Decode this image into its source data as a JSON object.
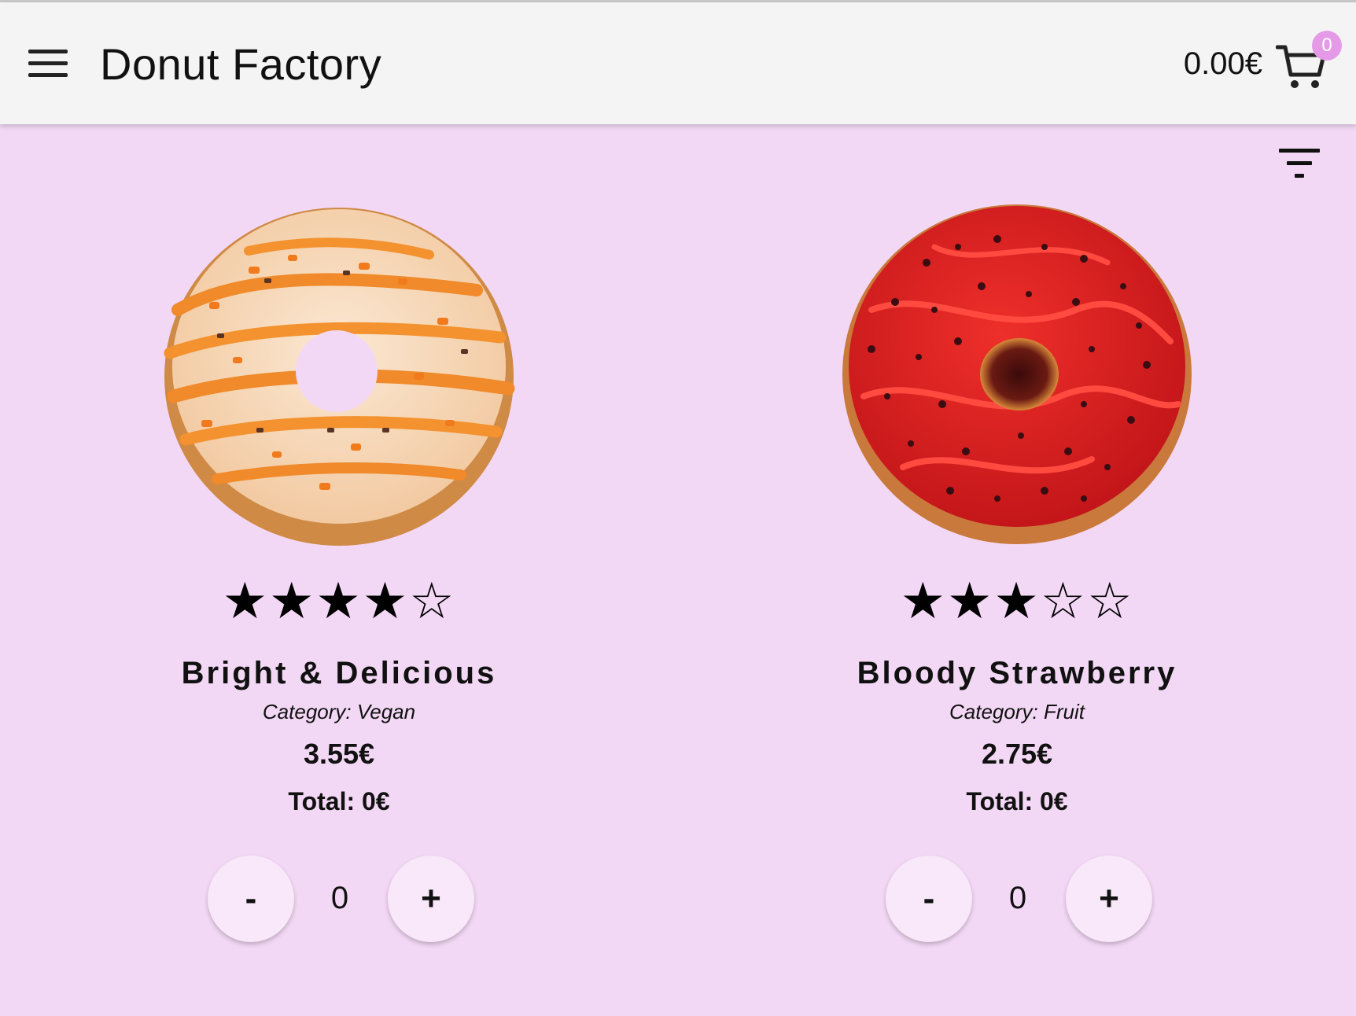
{
  "header": {
    "title": "Donut Factory",
    "cart_total": "0.00€",
    "cart_count": "0"
  },
  "icons": {
    "menu": "menu-icon",
    "cart": "cart-icon",
    "filter": "filter-icon"
  },
  "products": [
    {
      "name": "Bright & Delicious",
      "category": "Category: Vegan",
      "price": "3.55€",
      "total": "Total: 0€",
      "quantity": "0",
      "rating": 4,
      "rating_max": 5,
      "rating_stars": "★★★★☆",
      "minus_label": "-",
      "plus_label": "+",
      "image": "orange-glazed-donut",
      "colors": {
        "icing": "#f6d7b6",
        "drizzle": "#f08a2a",
        "dough": "#d9924a"
      }
    },
    {
      "name": "Bloody Strawberry",
      "category": "Category: Fruit",
      "price": "2.75€",
      "total": "Total: 0€",
      "quantity": "0",
      "rating": 3,
      "rating_max": 5,
      "rating_stars": "★★★☆☆",
      "minus_label": "-",
      "plus_label": "+",
      "image": "red-glazed-donut",
      "colors": {
        "icing": "#d9221f",
        "drizzle": "#ee3a33",
        "dough": "#c9793b"
      }
    }
  ],
  "colors": {
    "background": "#f3d8f5",
    "appbar": "#f4f4f4",
    "badge": "#e59ae8",
    "button": "#f8e8f9"
  }
}
